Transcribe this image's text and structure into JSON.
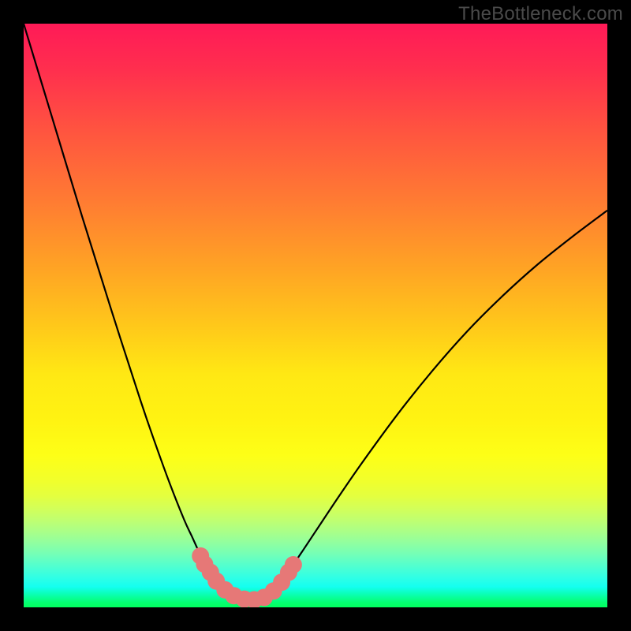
{
  "attribution": "TheBottleneck.com",
  "chart_data": {
    "type": "line",
    "title": "",
    "xlabel": "",
    "ylabel": "",
    "xlim": [
      0,
      1
    ],
    "ylim": [
      0,
      1
    ],
    "series": [
      {
        "name": "left-curve",
        "x": [
          0.0,
          0.05,
          0.1,
          0.15,
          0.2,
          0.225,
          0.25,
          0.275,
          0.288,
          0.3,
          0.312,
          0.325,
          0.35,
          0.375,
          0.39
        ],
        "y": [
          1.0,
          0.835,
          0.67,
          0.51,
          0.355,
          0.282,
          0.213,
          0.15,
          0.122,
          0.096,
          0.075,
          0.057,
          0.03,
          0.014,
          0.01
        ]
      },
      {
        "name": "right-curve",
        "x": [
          0.39,
          0.41,
          0.43,
          0.445,
          0.47,
          0.5,
          0.54,
          0.58,
          0.64,
          0.7,
          0.76,
          0.82,
          0.88,
          0.94,
          1.0
        ],
        "y": [
          0.01,
          0.018,
          0.033,
          0.05,
          0.085,
          0.13,
          0.19,
          0.248,
          0.33,
          0.405,
          0.473,
          0.533,
          0.587,
          0.635,
          0.68
        ]
      }
    ],
    "markers": {
      "color": "#e67877",
      "points": [
        {
          "x": 0.303,
          "y": 0.088
        },
        {
          "x": 0.31,
          "y": 0.074
        },
        {
          "x": 0.32,
          "y": 0.06
        },
        {
          "x": 0.33,
          "y": 0.045
        },
        {
          "x": 0.345,
          "y": 0.03
        },
        {
          "x": 0.36,
          "y": 0.02
        },
        {
          "x": 0.378,
          "y": 0.014
        },
        {
          "x": 0.395,
          "y": 0.013
        },
        {
          "x": 0.412,
          "y": 0.017
        },
        {
          "x": 0.428,
          "y": 0.028
        },
        {
          "x": 0.442,
          "y": 0.043
        },
        {
          "x": 0.454,
          "y": 0.06
        },
        {
          "x": 0.462,
          "y": 0.073
        }
      ],
      "radius_px": 11
    },
    "colors": {
      "curve": "#000000",
      "marker": "#e67877",
      "background_top": "#ff1a57",
      "background_bottom": "#02ff60",
      "frame": "#000000"
    }
  }
}
